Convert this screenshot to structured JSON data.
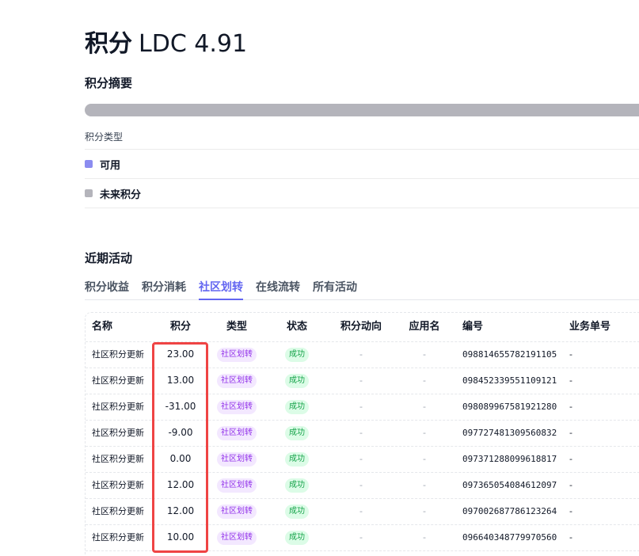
{
  "header": {
    "title": "积分",
    "subtitle": "LDC 4.91"
  },
  "summary": {
    "title": "积分摘要",
    "progress_available_fraction": 0,
    "legend_header": "积分类型",
    "legend": [
      {
        "label": "可用",
        "color": "#8b8cf0"
      },
      {
        "label": "未来积分",
        "color": "#b4b4bb"
      }
    ]
  },
  "activity": {
    "title": "近期活动",
    "tabs": [
      {
        "label": "积分收益",
        "active": false
      },
      {
        "label": "积分消耗",
        "active": false
      },
      {
        "label": "社区划转",
        "active": true
      },
      {
        "label": "在线流转",
        "active": false
      },
      {
        "label": "所有活动",
        "active": false
      }
    ],
    "columns": [
      "名称",
      "积分",
      "类型",
      "状态",
      "积分动向",
      "应用名",
      "编号",
      "业务单号"
    ],
    "rows": [
      {
        "name": "社区积分更新",
        "points": "23.00",
        "type": "社区划转",
        "status": "成功",
        "direction": "-",
        "app": "-",
        "id": "098814655782191105",
        "biz": "-"
      },
      {
        "name": "社区积分更新",
        "points": "13.00",
        "type": "社区划转",
        "status": "成功",
        "direction": "-",
        "app": "-",
        "id": "098452339551109121",
        "biz": "-"
      },
      {
        "name": "社区积分更新",
        "points": "-31.00",
        "type": "社区划转",
        "status": "成功",
        "direction": "-",
        "app": "-",
        "id": "098089967581921280",
        "biz": "-"
      },
      {
        "name": "社区积分更新",
        "points": "-9.00",
        "type": "社区划转",
        "status": "成功",
        "direction": "-",
        "app": "-",
        "id": "097727481309560832",
        "biz": "-"
      },
      {
        "name": "社区积分更新",
        "points": "0.00",
        "type": "社区划转",
        "status": "成功",
        "direction": "-",
        "app": "-",
        "id": "097371288099618817",
        "biz": "-"
      },
      {
        "name": "社区积分更新",
        "points": "12.00",
        "type": "社区划转",
        "status": "成功",
        "direction": "-",
        "app": "-",
        "id": "097365054084612097",
        "biz": "-"
      },
      {
        "name": "社区积分更新",
        "points": "12.00",
        "type": "社区划转",
        "status": "成功",
        "direction": "-",
        "app": "-",
        "id": "097002687786123264",
        "biz": "-"
      },
      {
        "name": "社区积分更新",
        "points": "10.00",
        "type": "社区划转",
        "status": "成功",
        "direction": "-",
        "app": "-",
        "id": "096640348779970560",
        "biz": "-"
      }
    ]
  }
}
